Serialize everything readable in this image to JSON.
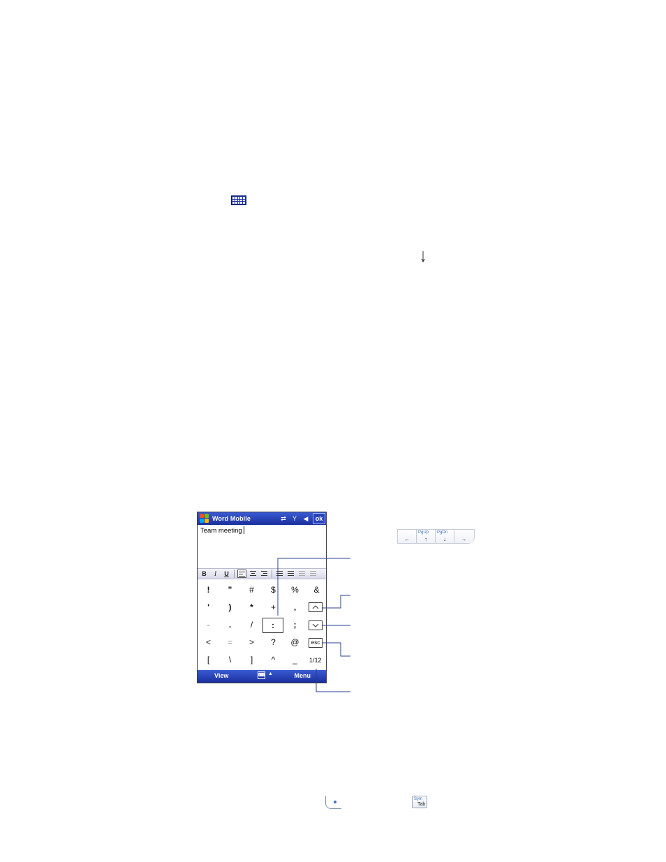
{
  "toolbar_icon": "keyboard-icon",
  "phone": {
    "title_bar": {
      "app_title": "Word Mobile",
      "ok_label": "ok",
      "icons": [
        "connectivity-icon",
        "signal-icon",
        "volume-icon"
      ]
    },
    "document": {
      "text": "Team meeting"
    },
    "format_bar": {
      "bold": "B",
      "italic": "I",
      "underline": "U"
    },
    "symbols": [
      [
        "!",
        "\"",
        "#",
        "$",
        "%",
        "&"
      ],
      [
        "'",
        ")",
        "*",
        "+",
        ",",
        ""
      ],
      [
        "-",
        ".",
        "/",
        ":",
        ";",
        ""
      ],
      [
        "<",
        "=",
        ">",
        "?",
        "@",
        ""
      ],
      [
        "[",
        "\\",
        "]",
        "^",
        "_",
        ""
      ]
    ],
    "controls": {
      "esc_label": "esc",
      "page_indicator": "1/12"
    },
    "menu_bar": {
      "left": "View",
      "right": "Menu"
    }
  },
  "key_strip": {
    "keys": [
      {
        "label": "",
        "arrow": "←"
      },
      {
        "label": "PgUp",
        "arrow": "↑"
      },
      {
        "label": "PgDn",
        "arrow": "↓"
      },
      {
        "label": "",
        "arrow": "→"
      }
    ]
  },
  "bottom_keys": {
    "symtab_top": "Sym",
    "symtab_bottom": "Tab"
  },
  "colors": {
    "title_bar": "#1a2f9c",
    "accent": "#3a6fc4"
  }
}
